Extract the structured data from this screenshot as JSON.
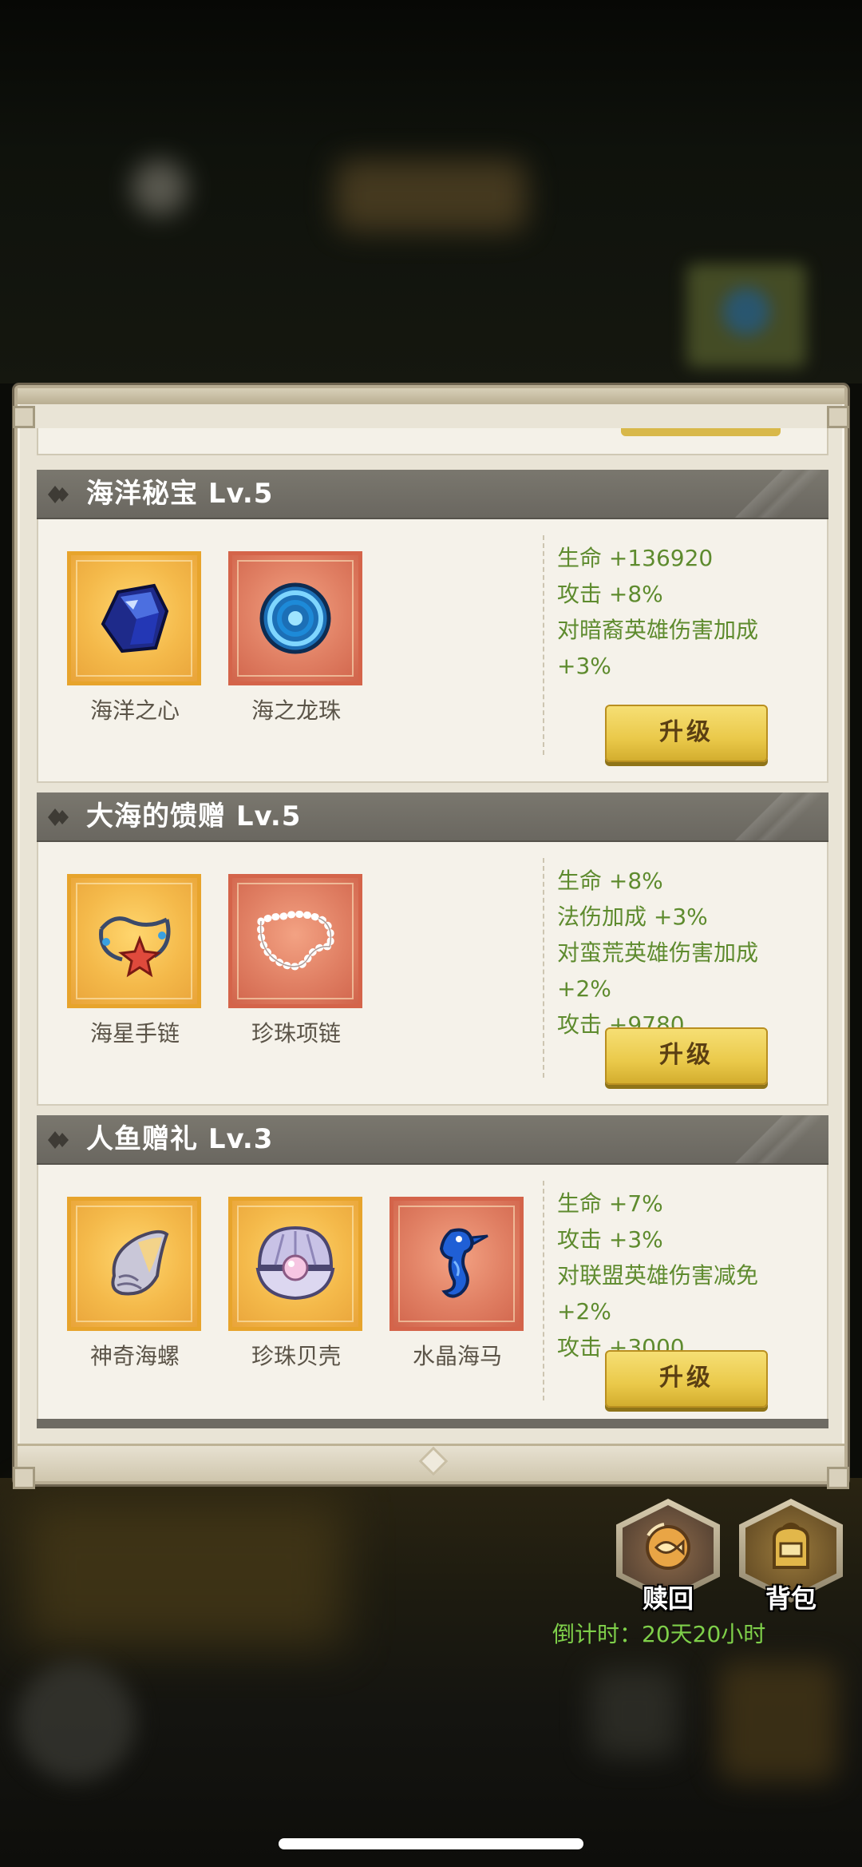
{
  "sections": [
    {
      "title": "海洋秘宝 Lv.5",
      "items": [
        {
          "name": "海洋之心",
          "icon": "blue-gem-icon",
          "frame": "gold"
        },
        {
          "name": "海之龙珠",
          "icon": "swirl-orb-icon",
          "frame": "red"
        }
      ],
      "stats": [
        "生命 +136920",
        "攻击 +8%",
        "对暗裔英雄伤害加成",
        "+3%"
      ],
      "button": "升级"
    },
    {
      "title": "大海的馈赠 Lv.5",
      "items": [
        {
          "name": "海星手链",
          "icon": "starfish-bracelet-icon",
          "frame": "gold"
        },
        {
          "name": "珍珠项链",
          "icon": "pearl-necklace-icon",
          "frame": "red"
        }
      ],
      "stats": [
        "生命 +8%",
        "法伤加成 +3%",
        "对蛮荒英雄伤害加成",
        "+2%",
        "攻击 +9780"
      ],
      "button": "升级"
    },
    {
      "title": "人鱼赠礼 Lv.3",
      "items": [
        {
          "name": "神奇海螺",
          "icon": "conch-shell-icon",
          "frame": "gold"
        },
        {
          "name": "珍珠贝壳",
          "icon": "pearl-clam-icon",
          "frame": "gold"
        },
        {
          "name": "水晶海马",
          "icon": "seahorse-icon",
          "frame": "red"
        }
      ],
      "stats": [
        "生命 +7%",
        "攻击 +3%",
        "对联盟英雄伤害减免",
        "+2%",
        "攻击 +3000"
      ],
      "button": "升级"
    }
  ],
  "actions": {
    "redeem_label": "赎回",
    "bag_label": "背包"
  },
  "countdown": "倒计时：20天20小时",
  "colors": {
    "stat_text": "#5e8b2e",
    "countdown_text": "#7fd04a",
    "button_gold": "#eac94a",
    "header_bg": "#7a776e"
  }
}
